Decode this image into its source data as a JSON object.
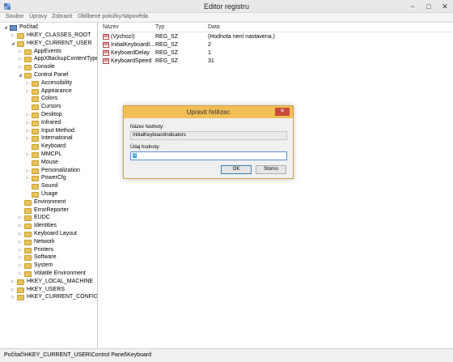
{
  "window": {
    "title": "Editor registru",
    "minimize": "−",
    "maximize": "□",
    "close": "✕"
  },
  "menu": [
    "Soubor",
    "Úpravy",
    "Zobrazit",
    "Oblíbené položky",
    "Nápověda"
  ],
  "tree": {
    "root": "Počítač",
    "items": [
      {
        "label": "HKEY_CLASSES_ROOT",
        "level": 1,
        "expander": "▷"
      },
      {
        "label": "HKEY_CURRENT_USER",
        "level": 1,
        "expander": "◢"
      },
      {
        "label": "AppEvents",
        "level": 2,
        "expander": "▷"
      },
      {
        "label": "AppXBackupContentType",
        "level": 2,
        "expander": "▷"
      },
      {
        "label": "Console",
        "level": 2,
        "expander": "▷"
      },
      {
        "label": "Control Panel",
        "level": 2,
        "expander": "◢"
      },
      {
        "label": "Accessibility",
        "level": 3,
        "expander": "▷"
      },
      {
        "label": "Appearance",
        "level": 3,
        "expander": "▷"
      },
      {
        "label": "Colors",
        "level": 3,
        "expander": ""
      },
      {
        "label": "Cursors",
        "level": 3,
        "expander": ""
      },
      {
        "label": "Desktop",
        "level": 3,
        "expander": "▷"
      },
      {
        "label": "Infrared",
        "level": 3,
        "expander": "▷"
      },
      {
        "label": "Input Method",
        "level": 3,
        "expander": "▷"
      },
      {
        "label": "International",
        "level": 3,
        "expander": "▷"
      },
      {
        "label": "Keyboard",
        "level": 3,
        "expander": ""
      },
      {
        "label": "MMCPL",
        "level": 3,
        "expander": "▷"
      },
      {
        "label": "Mouse",
        "level": 3,
        "expander": ""
      },
      {
        "label": "Personalization",
        "level": 3,
        "expander": "▷"
      },
      {
        "label": "PowerCfg",
        "level": 3,
        "expander": "▷"
      },
      {
        "label": "Sound",
        "level": 3,
        "expander": ""
      },
      {
        "label": "Usage",
        "level": 3,
        "expander": ""
      },
      {
        "label": "Environment",
        "level": 2,
        "expander": ""
      },
      {
        "label": "ErrorReporter",
        "level": 2,
        "expander": ""
      },
      {
        "label": "EUDC",
        "level": 2,
        "expander": "▷"
      },
      {
        "label": "Identities",
        "level": 2,
        "expander": "▷"
      },
      {
        "label": "Keyboard Layout",
        "level": 2,
        "expander": "▷"
      },
      {
        "label": "Network",
        "level": 2,
        "expander": "▷"
      },
      {
        "label": "Printers",
        "level": 2,
        "expander": "▷"
      },
      {
        "label": "Software",
        "level": 2,
        "expander": "▷"
      },
      {
        "label": "System",
        "level": 2,
        "expander": "▷"
      },
      {
        "label": "Volatile Environment",
        "level": 2,
        "expander": "▷"
      },
      {
        "label": "HKEY_LOCAL_MACHINE",
        "level": 1,
        "expander": "▷"
      },
      {
        "label": "HKEY_USERS",
        "level": 1,
        "expander": "▷"
      },
      {
        "label": "HKEY_CURRENT_CONFIG",
        "level": 1,
        "expander": "▷"
      }
    ]
  },
  "list": {
    "columns": [
      "Název",
      "Typ",
      "Data"
    ],
    "rows": [
      {
        "name": "(Výchozí)",
        "type": "REG_SZ",
        "data": "(Hodnota není nastavena.)"
      },
      {
        "name": "InitialKeyboardI...",
        "type": "REG_SZ",
        "data": "2"
      },
      {
        "name": "KeyboardDelay",
        "type": "REG_SZ",
        "data": "1"
      },
      {
        "name": "KeyboardSpeed",
        "type": "REG_SZ",
        "data": "31"
      }
    ]
  },
  "status": "Počítač\\HKEY_CURRENT_USER\\Control Panel\\Keyboard",
  "dialog": {
    "title": "Upravit řetězec",
    "close": "✕",
    "name_label": "Název hodnoty:",
    "name_value": "InitialKeyboardIndicators",
    "data_label": "Údaj hodnoty:",
    "data_value": "0",
    "ok": "OK",
    "cancel": "Storno"
  }
}
